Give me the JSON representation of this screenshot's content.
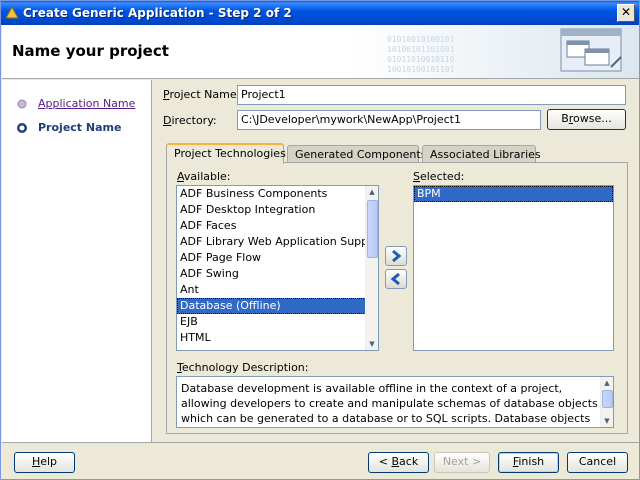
{
  "window": {
    "title": "Create Generic Application - Step 2 of 2",
    "close_label": "✕"
  },
  "header": {
    "title": "Name your project",
    "binary_decoration": "01010010100101\n10100101101001\n01011010010110\n10010100101101"
  },
  "nav": {
    "items": [
      {
        "label": "Application Name",
        "state": "visited"
      },
      {
        "label": "Project Name",
        "state": "current"
      }
    ]
  },
  "form": {
    "project_name_label_prefix": "",
    "project_name_label_u": "P",
    "project_name_label_rest": "roject Name:",
    "project_name_value": "Project1",
    "directory_label_prefix": "",
    "directory_label_u": "D",
    "directory_label_rest": "irectory:",
    "directory_value": "C:\\JDeveloper\\mywork\\NewApp\\Project1",
    "browse_label_prefix": "B",
    "browse_label_u": "r",
    "browse_label_rest": "owse..."
  },
  "tabs": [
    {
      "label": "Project Technologies",
      "active": true
    },
    {
      "label": "Generated Components",
      "active": false
    },
    {
      "label": "Associated Libraries",
      "active": false
    }
  ],
  "available": {
    "label_u": "A",
    "label_rest": "vailable:",
    "items": [
      "ADF Business Components",
      "ADF Desktop Integration",
      "ADF Faces",
      "ADF Library Web Application Support",
      "ADF Page Flow",
      "ADF Swing",
      "Ant",
      "Database (Offline)",
      "EJB",
      "HTML"
    ],
    "selected_index": 7
  },
  "selected": {
    "label_u": "S",
    "label_rest": "elected:",
    "items": [
      "BPM"
    ],
    "selected_index": 0
  },
  "description": {
    "label_u": "T",
    "label_rest": "echnology Description:",
    "text": "Database development is available offline in the context of a project, allowing developers to create and manipulate schemas of database objects which can be generated to a database or to SQL scripts.  Database objects can also be imported"
  },
  "footer": {
    "help_u": "H",
    "help_rest": "elp",
    "back_prefix": "< ",
    "back_u": "B",
    "back_rest": "ack",
    "next_label": "Next >",
    "finish_u": "F",
    "finish_rest": "inish",
    "cancel_label": "Cancel"
  },
  "colors": {
    "selection": "#316ac5",
    "titlebar": "#0055e5",
    "active_tab_accent": "#f9b43f"
  }
}
